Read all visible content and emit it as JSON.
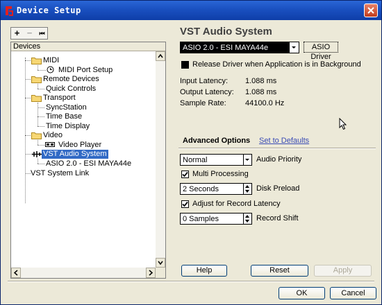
{
  "window": {
    "title": "Device Setup"
  },
  "toolbar": {
    "add": "+",
    "remove": "−",
    "reset": "⏮"
  },
  "devices_header": "Devices",
  "tree": {
    "midi": "MIDI",
    "midi_port_setup": "MIDI Port Setup",
    "remote_devices": "Remote Devices",
    "quick_controls": "Quick Controls",
    "transport": "Transport",
    "syncstation": "SyncStation",
    "time_base": "Time Base",
    "time_display": "Time Display",
    "video": "Video",
    "video_player": "Video Player",
    "vst_audio_system": "VST Audio System",
    "asio_device": "ASIO 2.0 - ESI MAYA44e",
    "vst_system_link": "VST System Link"
  },
  "panel": {
    "title": "VST Audio System",
    "driver": "ASIO 2.0 - ESI MAYA44e",
    "asio_driver_btn": "ASIO Driver",
    "release_driver": "Release Driver when Application is in Background",
    "release_driver_checked": false,
    "input_latency_label": "Input Latency:",
    "input_latency": "1.088 ms",
    "output_latency_label": "Output Latency:",
    "output_latency": "1.088 ms",
    "sample_rate_label": "Sample Rate:",
    "sample_rate": "44100.0 Hz",
    "advanced_options": "Advanced Options",
    "set_to_defaults": "Set to Defaults",
    "audio_priority_value": "Normal",
    "audio_priority_label": "Audio Priority",
    "multi_processing": "Multi Processing",
    "multi_processing_checked": true,
    "disk_preload_value": "2 Seconds",
    "disk_preload_label": "Disk Preload",
    "adjust_latency": "Adjust for Record Latency",
    "adjust_latency_checked": true,
    "record_shift_value": "0 Samples",
    "record_shift_label": "Record Shift",
    "help": "Help",
    "reset": "Reset",
    "apply": "Apply"
  },
  "dialog": {
    "ok": "OK",
    "cancel": "Cancel"
  }
}
